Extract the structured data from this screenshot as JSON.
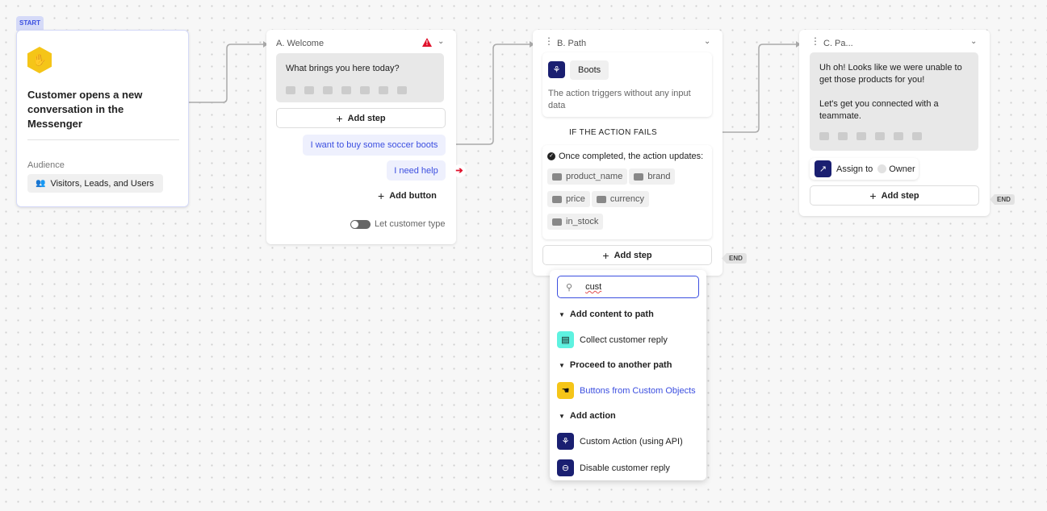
{
  "start": {
    "tag": "START",
    "title": "Customer opens a new conversation in the Messenger",
    "audience_label": "Audience",
    "audience_value": "Visitors, Leads, and Users"
  },
  "welcome": {
    "title": "A. Welcome",
    "message": "What brings you here today?",
    "add_step": "Add step",
    "buttons": [
      "I want to buy some soccer boots",
      "I need help"
    ],
    "add_button": "Add button",
    "toggle_label": "Let customer type",
    "toggle_on": false
  },
  "path_b": {
    "title": "B. Path",
    "action_name": "Boots",
    "action_desc": "The action triggers without any input data",
    "fail_label": "IF THE ACTION FAILS",
    "updates_label": "Once completed, the action updates:",
    "attributes": [
      "product_name",
      "brand",
      "price",
      "currency",
      "in_stock"
    ],
    "add_step": "Add step",
    "end": "END"
  },
  "dropdown": {
    "search_value": "cust",
    "sections": [
      {
        "label": "Add content to path",
        "items": [
          {
            "label": "Collect customer reply",
            "icon": "chat-icon",
            "color": "#5ef2e0"
          }
        ]
      },
      {
        "label": "Proceed to another path",
        "items": [
          {
            "label": "Buttons from Custom Objects",
            "icon": "pointer-icon",
            "color": "#f5c518"
          }
        ]
      },
      {
        "label": "Add action",
        "items": [
          {
            "label": "Custom Action (using API)",
            "icon": "webhook-icon",
            "color": "#1a1f71"
          },
          {
            "label": "Disable customer reply",
            "icon": "minus-circle-icon",
            "color": "#1a1f71"
          }
        ]
      }
    ]
  },
  "path_c": {
    "title": "C. Pa...",
    "message_line1": "Uh oh! Looks like we were unable to get those products for you!",
    "message_line2": "Let's get you connected with a teammate.",
    "assign_label": "Assign to",
    "assign_target": "Owner",
    "add_step": "Add step",
    "end": "END"
  },
  "colors": {
    "accent": "#3c4fe0",
    "warning": "#e0112b",
    "navy": "#1a1f71",
    "yellow": "#f5c518"
  }
}
